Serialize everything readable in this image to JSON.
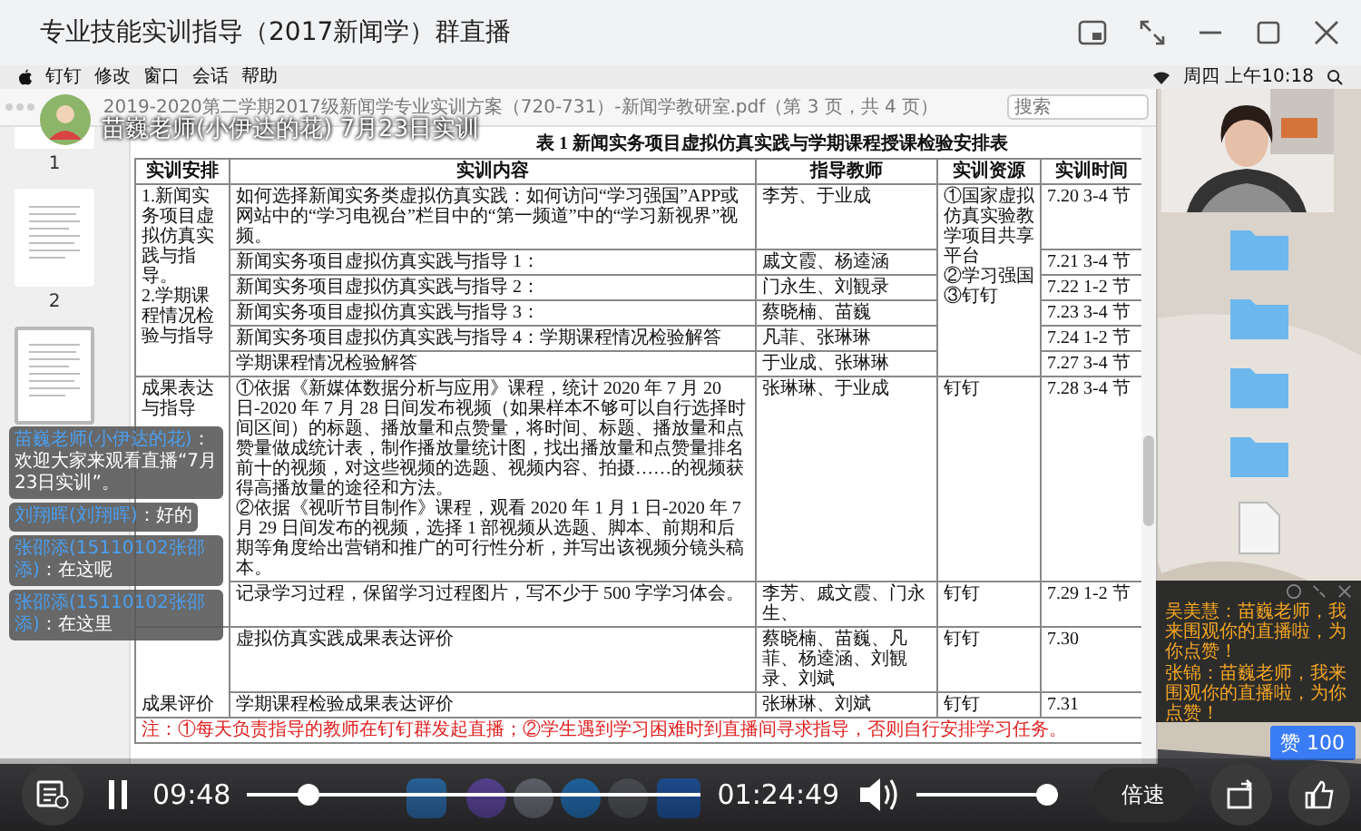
{
  "window": {
    "title": "专业技能实训指导（2017新闻学）群直播"
  },
  "mac_menu": {
    "items": [
      "钉钉",
      "修改",
      "窗口",
      "会话",
      "帮助"
    ],
    "clock": "周四 上午10:18"
  },
  "viewer": {
    "file_title": "2019-2020第二学期2017级新闻学专业实训方案（720-731）-新闻学教研室.pdf（第 3 页，共 4 页）",
    "search_placeholder": "搜索",
    "thumbnails": [
      {
        "label": "1",
        "selected": false
      },
      {
        "label": "2",
        "selected": false
      },
      {
        "selected": true
      }
    ]
  },
  "table": {
    "title": "表 1 新闻实务项目虚拟仿真实践与学期课程授课检验安排表",
    "columns": [
      "实训安排",
      "实训内容",
      "指导教师",
      "实训资源",
      "实训时间"
    ],
    "sections": [
      {
        "arrangement": "1.新闻实务项目虚拟仿真实践与指导。\n2.学期课程情况检验与指导",
        "resource": "①国家虚拟仿真实验教学项目共享平台\n②学习强国\n③钉钉",
        "rows": [
          {
            "content": "如何选择新闻实务类虚拟仿真实践：如何访问“学习强国”APP或网站中的“学习电视台”栏目中的“第一频道”中的“学习新视界”视频。",
            "teacher": "李芳、于业成",
            "time": "7.20 3-4 节"
          },
          {
            "content": "新闻实务项目虚拟仿真实践与指导 1：",
            "teacher": "戚文霞、杨逵涵",
            "time": "7.21 3-4 节"
          },
          {
            "content": "新闻实务项目虚拟仿真实践与指导 2：",
            "teacher": "门永生、刘観录",
            "time": "7.22 1-2 节"
          },
          {
            "content": "新闻实务项目虚拟仿真实践与指导 3：",
            "teacher": "蔡晓楠、苗巍",
            "time": "7.23 3-4 节"
          },
          {
            "content": "新闻实务项目虚拟仿真实践与指导 4：学期课程情况检验解答",
            "teacher": "凡菲、张琳琳",
            "time": "7.24 1-2 节"
          },
          {
            "content": "学期课程情况检验解答",
            "teacher": "于业成、张琳琳",
            "time": "7.27 3-4 节"
          }
        ]
      },
      {
        "arrangement": "成果表达与指导",
        "rows": [
          {
            "content": "①依据《新媒体数据分析与应用》课程，统计 2020 年 7 月 20 日-2020 年 7 月 28 日间发布视频（如果样本不够可以自行选择时间区间）的标题、播放量和点赞量，将时间、标题、播放量和点赞量做成统计表，制作播放量统计图，找出播放量和点赞量排名前十的视频，对这些视频的选题、视频内容、拍摄……的视频获得高播放量的途径和方法。\n②依据《视听节目制作》课程，观看 2020 年 1 月 1 日-2020 年 7 月 29 日间发布的视频，选择 1 部视频从选题、脚本、前期和后期等角度给出营销和推广的可行性分析，并写出该视频分镜头稿本。",
            "teacher": "张琳琳、于业成",
            "resource": "钉钉",
            "time": "7.28 3-4 节"
          },
          {
            "content": "记录学习过程，保留学习过程图片，写不少于 500 字学习体会。",
            "teacher": "李芳、戚文霞、门永生、",
            "resource": "钉钉",
            "time": "7.29 1-2 节"
          }
        ]
      },
      {
        "arrangement": "成果评价",
        "rows": [
          {
            "content": "虚拟仿真实践成果表达评价",
            "teacher": "蔡晓楠、苗巍、凡菲、杨逵涵、刘観录、刘斌",
            "resource": "钉钉",
            "time": "7.30"
          },
          {
            "content": "学期课程检验成果表达评价",
            "teacher": "张琳琳、刘斌",
            "resource": "钉钉",
            "time": "7.31"
          }
        ]
      }
    ],
    "note": "注：①每天负责指导的教师在钉钉群发起直播；②学生遇到学习困难时到直播间寻求指导，否则自行安排学习任务。"
  },
  "host": {
    "name": "苗巍老师(小伊达的花)",
    "topic": "7月23日实训"
  },
  "chat": [
    {
      "user": "苗巍老师(小伊达的花)",
      "text": "：欢迎大家来观看直播“7月23日实训”。"
    },
    {
      "user": "刘翔晖(刘翔晖)",
      "text": "：好的"
    },
    {
      "user": "张邵添(15110102张邵添)",
      "text": "：在这呢"
    },
    {
      "user": "张邵添(15110102张邵添)",
      "text": "：在这里"
    }
  ],
  "comments": [
    "吴美慧：苗巍老师，我来围观你的直播啦，为你点赞！",
    "张锦：苗巍老师，我来围观你的直播啦，为你点赞！"
  ],
  "likes_badge": "赞 100",
  "player": {
    "playing": true,
    "elapsed": "09:48",
    "duration": "01:24:49",
    "progress": {
      "level": 0.115
    },
    "volume": {
      "level": 1.0
    },
    "speed_button": "倍速"
  }
}
